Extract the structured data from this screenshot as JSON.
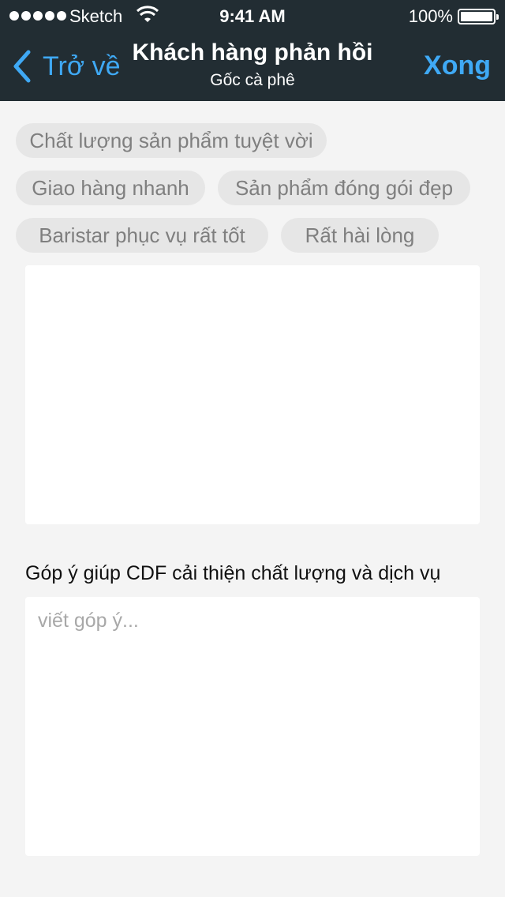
{
  "status_bar": {
    "carrier": "Sketch",
    "time": "9:41 AM",
    "battery": "100%",
    "battery_level": 1.0
  },
  "nav": {
    "back_label": "Trở về",
    "title": "Khách hàng phản hồi",
    "subtitle": "Gốc cà phê",
    "done_label": "Xong"
  },
  "tags": [
    "Chất lượng sản phẩm tuyệt vời",
    "Giao hàng nhanh",
    "Sản phẩm đóng gói đẹp",
    "Baristar phục vụ rất tốt",
    "Rất hài lòng"
  ],
  "feedback": {
    "label": "Góp ý giúp CDF cải thiện chất lượng và dịch vụ",
    "placeholder": "viết góp ý...",
    "value": ""
  },
  "colors": {
    "header_bg": "#222d33",
    "accent": "#3fa9f5",
    "background": "#f4f4f4",
    "tag_bg": "#e6e6e6"
  }
}
